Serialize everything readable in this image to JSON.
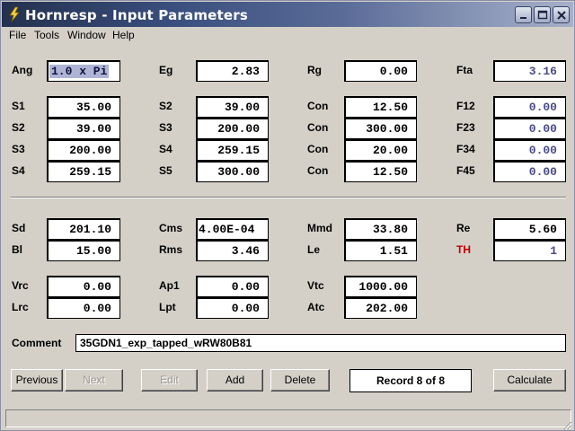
{
  "window": {
    "title": "Hornresp - Input Parameters"
  },
  "menu": {
    "file": "File",
    "tools": "Tools",
    "window": "Window",
    "help": "Help"
  },
  "params": {
    "ang": {
      "label": "Ang",
      "value": "1.0 x Pi"
    },
    "eg": {
      "label": "Eg",
      "value": "2.83"
    },
    "rg": {
      "label": "Rg",
      "value": "0.00"
    },
    "fta": {
      "label": "Fta",
      "value": "3.16"
    },
    "s1": {
      "label": "S1",
      "value": "35.00"
    },
    "s2a": {
      "label": "S2",
      "value": "39.00"
    },
    "s3a": {
      "label": "S3",
      "value": "200.00"
    },
    "s4a": {
      "label": "S4",
      "value": "259.15"
    },
    "s2b": {
      "label": "S2",
      "value": "39.00"
    },
    "s3b": {
      "label": "S3",
      "value": "200.00"
    },
    "s4b": {
      "label": "S4",
      "value": "259.15"
    },
    "s5": {
      "label": "S5",
      "value": "300.00"
    },
    "con1": {
      "label": "Con",
      "value": "12.50"
    },
    "con2": {
      "label": "Con",
      "value": "300.00"
    },
    "con3": {
      "label": "Con",
      "value": "20.00"
    },
    "con4": {
      "label": "Con",
      "value": "12.50"
    },
    "f12": {
      "label": "F12",
      "value": "0.00"
    },
    "f23": {
      "label": "F23",
      "value": "0.00"
    },
    "f34": {
      "label": "F34",
      "value": "0.00"
    },
    "f45": {
      "label": "F45",
      "value": "0.00"
    },
    "sd": {
      "label": "Sd",
      "value": "201.10"
    },
    "bl": {
      "label": "Bl",
      "value": "15.00"
    },
    "cms": {
      "label": "Cms",
      "value": "4.00E-04"
    },
    "rms": {
      "label": "Rms",
      "value": "3.46"
    },
    "mmd": {
      "label": "Mmd",
      "value": "33.80"
    },
    "le": {
      "label": "Le",
      "value": "1.51"
    },
    "re": {
      "label": "Re",
      "value": "5.60"
    },
    "th": {
      "label": "TH",
      "value": "1"
    },
    "vrc": {
      "label": "Vrc",
      "value": "0.00"
    },
    "lrc": {
      "label": "Lrc",
      "value": "0.00"
    },
    "ap1": {
      "label": "Ap1",
      "value": "0.00"
    },
    "lpt": {
      "label": "Lpt",
      "value": "0.00"
    },
    "vtc": {
      "label": "Vtc",
      "value": "1000.00"
    },
    "atc": {
      "label": "Atc",
      "value": "202.00"
    }
  },
  "comment": {
    "label": "Comment",
    "value": "35GDN1_exp_tapped_wRW80B81"
  },
  "buttons": {
    "previous": "Previous",
    "next": "Next",
    "edit": "Edit",
    "add": "Add",
    "delete": "Delete",
    "calculate": "Calculate"
  },
  "record": "Record 8 of 8",
  "colors": {
    "title_gradient_start": "#24314e",
    "title_gradient_end": "#a6b0c8",
    "th_label": "#c00000",
    "selection": "#aeb5d4"
  }
}
